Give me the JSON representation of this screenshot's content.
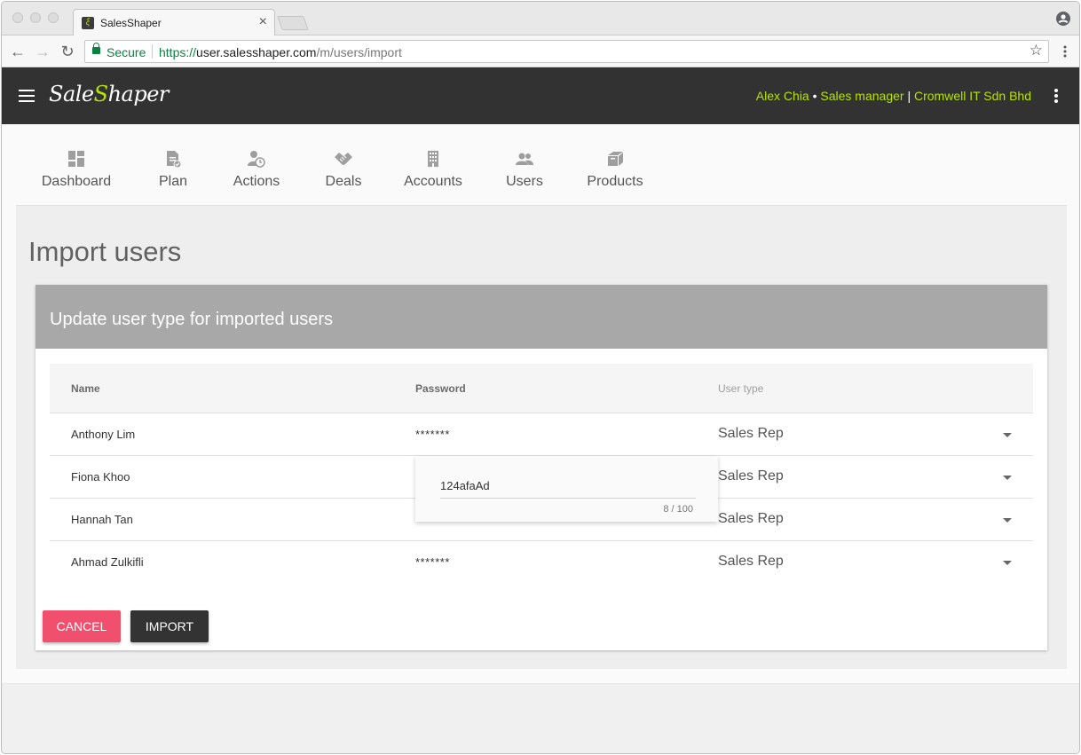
{
  "browser": {
    "tab_title": "SalesShaper",
    "tab_close": "×",
    "secure_label": "Secure",
    "url_scheme": "https://",
    "url_host": "user.salesshaper.com",
    "url_path": "/m/users/import"
  },
  "appbar": {
    "logo_pre": "Sale",
    "logo_mid": "S",
    "logo_post": "haper",
    "user_name": "Alex Chia",
    "dot": " • ",
    "role": "Sales manager",
    "pipe": " | ",
    "company": "Cromwell IT Sdn Bhd"
  },
  "nav": {
    "items": [
      {
        "label": "Dashboard",
        "icon": "dashboard-icon"
      },
      {
        "label": "Plan",
        "icon": "plan-icon"
      },
      {
        "label": "Actions",
        "icon": "actions-icon"
      },
      {
        "label": "Deals",
        "icon": "deals-icon"
      },
      {
        "label": "Accounts",
        "icon": "accounts-icon"
      },
      {
        "label": "Users",
        "icon": "users-icon"
      },
      {
        "label": "Products",
        "icon": "products-icon"
      }
    ]
  },
  "page": {
    "title": "Import users",
    "card_title": "Update user type for imported users"
  },
  "table": {
    "headers": {
      "name": "Name",
      "password": "Password",
      "user_type": "User type"
    },
    "rows": [
      {
        "name": "Anthony Lim",
        "password": "*******",
        "user_type": "Sales Rep"
      },
      {
        "name": "Fiona Khoo",
        "password": "",
        "user_type": "Sales Rep"
      },
      {
        "name": "Hannah Tan",
        "password": "",
        "user_type": "Sales Rep"
      },
      {
        "name": "Ahmad Zulkifli",
        "password": "*******",
        "user_type": "Sales Rep"
      }
    ]
  },
  "password_editor": {
    "value": "124afaAd",
    "counter": "8 / 100"
  },
  "actions": {
    "cancel": "Cancel",
    "import": "Import"
  },
  "colors": {
    "accent": "#b7e300",
    "appbar": "#323232",
    "cancel": "#f0506e",
    "card_header": "#a8a8a8"
  }
}
